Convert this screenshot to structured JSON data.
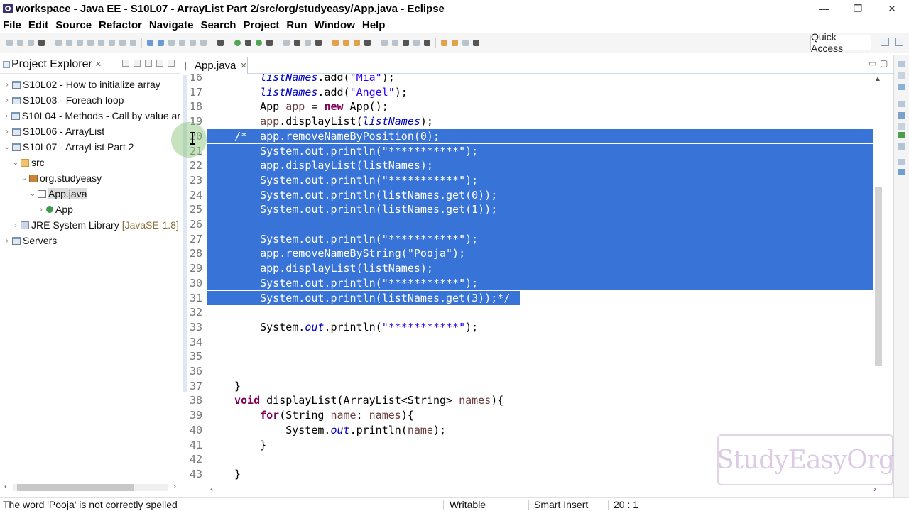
{
  "window": {
    "title": "workspace - Java EE - S10L07 - ArrayList Part 2/src/org/studyeasy/App.java - Eclipse",
    "minimize": "—",
    "restore": "❐",
    "close": "✕"
  },
  "menu": [
    "File",
    "Edit",
    "Source",
    "Refactor",
    "Navigate",
    "Search",
    "Project",
    "Run",
    "Window",
    "Help"
  ],
  "toolbar": {
    "quick_access": "Quick Access"
  },
  "explorer": {
    "title": "Project Explorer",
    "close_glyph": "✕",
    "items": [
      {
        "label": "S10L02 - How to initialize array",
        "decoration": "",
        "arrow": "›",
        "icon": "project-icon"
      },
      {
        "label": "S10L03 - Foreach loop",
        "decoration": "",
        "arrow": "›",
        "icon": "project-icon"
      },
      {
        "label": "S10L04 - Methods - Call by value ar",
        "decoration": "",
        "arrow": "›",
        "icon": "project-icon"
      },
      {
        "label": "S10L06 - ArrayList",
        "decoration": "",
        "arrow": "›",
        "icon": "project-icon"
      },
      {
        "label": "S10L07 - ArrayList Part 2",
        "decoration": "",
        "arrow": "⌄",
        "icon": "project-icon"
      },
      {
        "label": "src",
        "decoration": "",
        "arrow": "⌄",
        "icon": "source-folder-icon"
      },
      {
        "label": "org.studyeasy",
        "decoration": "",
        "arrow": "⌄",
        "icon": "package-icon"
      },
      {
        "label": "App.java",
        "decoration": "",
        "arrow": "⌄",
        "icon": "java-file-icon"
      },
      {
        "label": "App",
        "decoration": "",
        "arrow": "›",
        "icon": "class-icon"
      },
      {
        "label": "JRE System Library",
        "decoration": "[JavaSE-1.8]",
        "arrow": "›",
        "icon": "library-icon"
      },
      {
        "label": "Servers",
        "decoration": "",
        "arrow": "›",
        "icon": "project-icon"
      }
    ],
    "scroll_left": "‹",
    "scroll_right": "›"
  },
  "editor": {
    "tab_label": "App.java",
    "tab_close": "✕",
    "minimize_glyph": "▭",
    "maximize_glyph": "▢",
    "lines": [
      {
        "n": "16",
        "sel": false,
        "tokens": [
          [
            "    ",
            ""
          ],
          [
            "listNames",
            "fld"
          ],
          [
            ".add(",
            ""
          ],
          [
            "\"Mia\"",
            "str"
          ],
          [
            ");",
            ""
          ]
        ]
      },
      {
        "n": "17",
        "sel": false,
        "tokens": [
          [
            "    ",
            ""
          ],
          [
            "listNames",
            "fld"
          ],
          [
            ".add(",
            ""
          ],
          [
            "\"Angel\"",
            "str"
          ],
          [
            ");",
            ""
          ]
        ]
      },
      {
        "n": "18",
        "sel": false,
        "tokens": [
          [
            "    App ",
            ""
          ],
          [
            "app",
            "var"
          ],
          [
            " = ",
            ""
          ],
          [
            "new",
            "kw"
          ],
          [
            " App();",
            ""
          ]
        ]
      },
      {
        "n": "19",
        "sel": false,
        "tokens": [
          [
            "    ",
            ""
          ],
          [
            "app",
            "var"
          ],
          [
            ".displayList(",
            ""
          ],
          [
            "listNames",
            "fld"
          ],
          [
            ");",
            ""
          ]
        ]
      },
      {
        "n": "20",
        "sel": true,
        "tokens": [
          [
            "/*  app.removeNameByPosition(0);",
            ""
          ]
        ]
      },
      {
        "n": "21",
        "sel": true,
        "tokens": [
          [
            "    System.out.println(\"***********\");",
            ""
          ]
        ]
      },
      {
        "n": "22",
        "sel": true,
        "tokens": [
          [
            "    app.displayList(listNames);",
            ""
          ]
        ]
      },
      {
        "n": "23",
        "sel": true,
        "tokens": [
          [
            "    System.out.println(\"***********\");",
            ""
          ]
        ]
      },
      {
        "n": "24",
        "sel": true,
        "tokens": [
          [
            "    System.out.println(listNames.get(0));",
            ""
          ]
        ]
      },
      {
        "n": "25",
        "sel": true,
        "tokens": [
          [
            "    System.out.println(listNames.get(1));",
            ""
          ]
        ]
      },
      {
        "n": "26",
        "sel": true,
        "tokens": [
          [
            "",
            ""
          ]
        ]
      },
      {
        "n": "27",
        "sel": true,
        "tokens": [
          [
            "    System.out.println(\"***********\");",
            ""
          ]
        ]
      },
      {
        "n": "28",
        "sel": true,
        "tokens": [
          [
            "    app.removeNameByString(\"Pooja\");",
            ""
          ]
        ]
      },
      {
        "n": "29",
        "sel": true,
        "tokens": [
          [
            "    app.displayList(listNames);",
            ""
          ]
        ]
      },
      {
        "n": "30",
        "sel": true,
        "tokens": [
          [
            "    System.out.println(\"***********\");",
            ""
          ]
        ]
      },
      {
        "n": "31",
        "sel": true,
        "tokens": [
          [
            "    System.out.println(listNames.get(3));*/",
            ""
          ]
        ]
      },
      {
        "n": "32",
        "sel": false,
        "tokens": [
          [
            "",
            ""
          ]
        ]
      },
      {
        "n": "33",
        "sel": false,
        "tokens": [
          [
            "    System.",
            ""
          ],
          [
            "out",
            "fld"
          ],
          [
            ".println(",
            ""
          ],
          [
            "\"***********\"",
            "str"
          ],
          [
            ");",
            ""
          ]
        ]
      },
      {
        "n": "34",
        "sel": false,
        "tokens": [
          [
            "",
            ""
          ]
        ]
      },
      {
        "n": "35",
        "sel": false,
        "tokens": [
          [
            "",
            ""
          ]
        ]
      },
      {
        "n": "36",
        "sel": false,
        "tokens": [
          [
            "",
            ""
          ]
        ]
      },
      {
        "n": "37",
        "sel": false,
        "tokens": [
          [
            "}",
            ""
          ]
        ]
      },
      {
        "n": "38",
        "sel": false,
        "tokens": [
          [
            "",
            ""
          ],
          [
            "void",
            "kw"
          ],
          [
            " displayList(ArrayList<String> ",
            ""
          ],
          [
            "names",
            "var"
          ],
          [
            "){",
            ""
          ]
        ]
      },
      {
        "n": "39",
        "sel": false,
        "tokens": [
          [
            "    ",
            ""
          ],
          [
            "for",
            "kw"
          ],
          [
            "(String ",
            ""
          ],
          [
            "name",
            "var"
          ],
          [
            ": ",
            ""
          ],
          [
            "names",
            "var"
          ],
          [
            "){",
            ""
          ]
        ]
      },
      {
        "n": "40",
        "sel": false,
        "tokens": [
          [
            "        System.",
            ""
          ],
          [
            "out",
            "fld"
          ],
          [
            ".println(",
            ""
          ],
          [
            "name",
            "var"
          ],
          [
            ");",
            ""
          ]
        ]
      },
      {
        "n": "41",
        "sel": false,
        "tokens": [
          [
            "    }",
            ""
          ]
        ]
      },
      {
        "n": "42",
        "sel": false,
        "tokens": [
          [
            "",
            ""
          ]
        ]
      },
      {
        "n": "43",
        "sel": false,
        "tokens": [
          [
            "}",
            ""
          ]
        ]
      }
    ],
    "scroll_up": "▲",
    "scroll_left": "‹",
    "scroll_right": "›"
  },
  "watermark": {
    "text": "StudyEasyOrg"
  },
  "status": {
    "message": "The word 'Pooja' is not correctly spelled",
    "writable": "Writable",
    "insert_mode": "Smart Insert",
    "position": "20 : 1"
  }
}
